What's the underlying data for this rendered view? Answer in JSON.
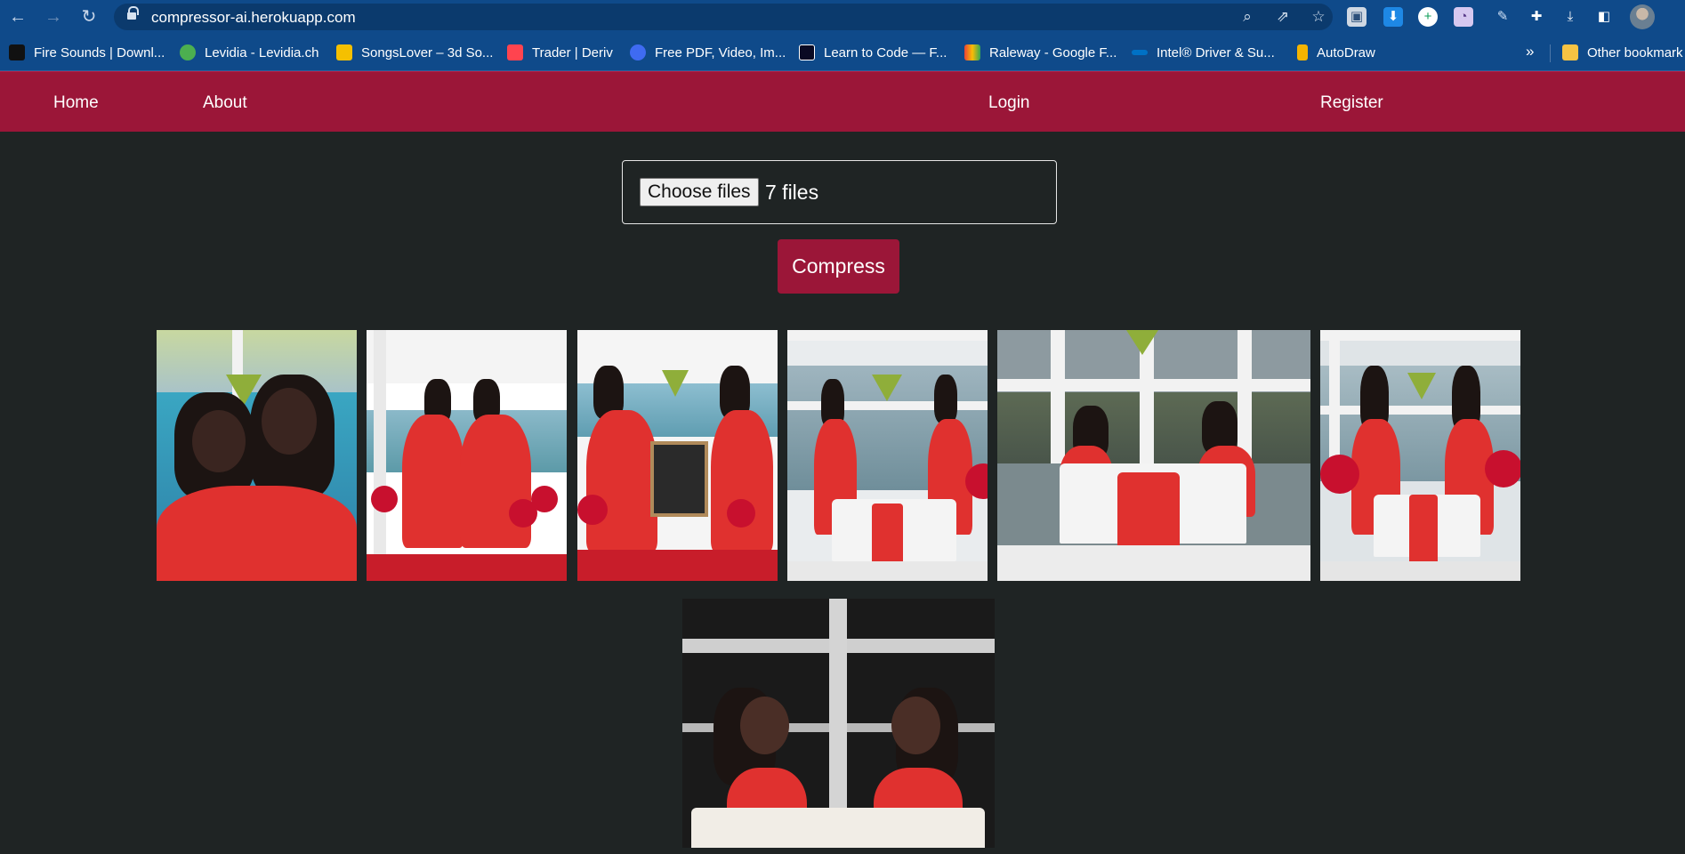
{
  "browser": {
    "url": "compressor-ai.herokuapp.com",
    "bookmarks": [
      {
        "label": "Fire Sounds | Downl...",
        "color": "#111111"
      },
      {
        "label": "Levidia - Levidia.ch",
        "color": "#4caf50"
      },
      {
        "label": "SongsLover – 3d So...",
        "color": "#f5c000"
      },
      {
        "label": "Trader | Deriv",
        "color": "#ff444f"
      },
      {
        "label": "Free PDF, Video, Im...",
        "color": "#3f6bf2"
      },
      {
        "label": "Learn to Code — F...",
        "color": "#0a0a23"
      },
      {
        "label": "Raleway - Google F...",
        "color": "#34a853"
      },
      {
        "label": "Intel® Driver & Su...",
        "color": "#0071c5"
      },
      {
        "label": "AutoDraw",
        "color": "#f4b400"
      }
    ],
    "bookmarks_more": "»",
    "other_bookmarks": "Other bookmark"
  },
  "site_nav": {
    "home": "Home",
    "about": "About",
    "login": "Login",
    "register": "Register"
  },
  "upload": {
    "choose_label": "Choose files",
    "file_count": "7 files"
  },
  "compress_label": "Compress",
  "colors": {
    "brand": "#9b1638",
    "page_bg": "#1f2424",
    "chrome": "#0f4a8a"
  },
  "photos": [
    {
      "scene": "hug-closeup"
    },
    {
      "scene": "pavilion-pose"
    },
    {
      "scene": "chalkboard-sign"
    },
    {
      "scene": "hanging-plant"
    },
    {
      "scene": "table-toast"
    },
    {
      "scene": "hanging-plant-back"
    },
    {
      "scene": "cake-feeding"
    }
  ]
}
